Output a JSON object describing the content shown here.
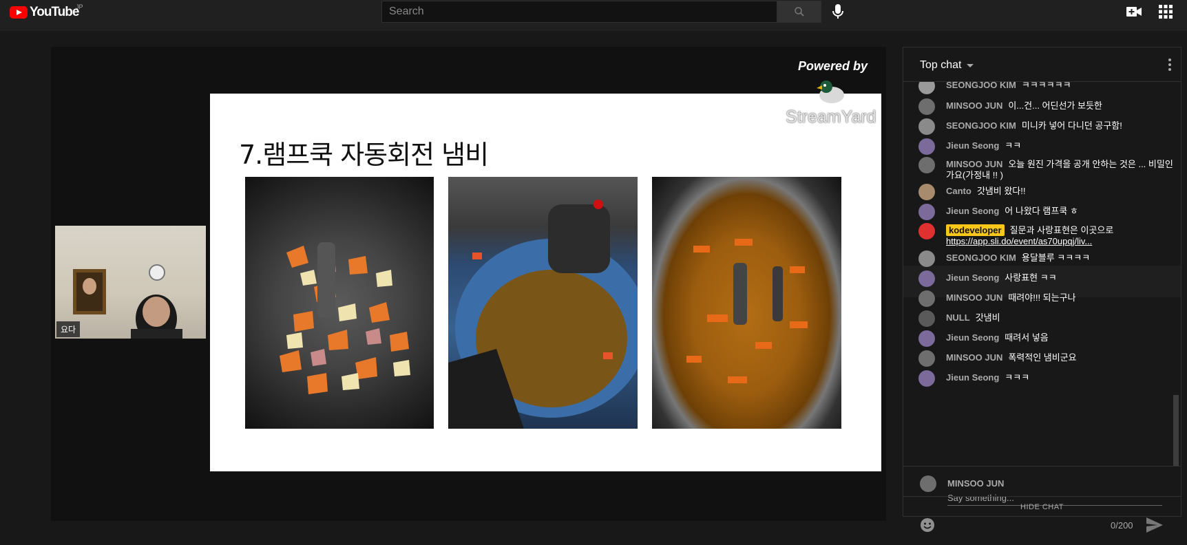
{
  "header": {
    "logo_text": "YouTube",
    "logo_region": "JP",
    "search_placeholder": "Search",
    "icons": [
      "youtube-logo",
      "search-icon",
      "mic-icon",
      "create-video-icon",
      "apps-icon"
    ]
  },
  "video": {
    "slide_title": "7.램프쿡 자동회전 냄비",
    "powered_by": "Powered by",
    "streamyard": "StreamYard",
    "presenter_name": "요다"
  },
  "chat": {
    "title": "Top chat",
    "messages": [
      {
        "author": "SEONGJOO KIM",
        "text": "ㅋㅋㅋㅋㅋㅋ",
        "avatar_color": "#9a9a9a"
      },
      {
        "author": "MINSOO JUN",
        "text": "이...건... 어딘선가 보듯한",
        "avatar_color": "#6e6e6e"
      },
      {
        "author": "SEONGJOO KIM",
        "text": "미니카 넣어 다니던 공구함!",
        "avatar_color": "#8a8a8a"
      },
      {
        "author": "Jieun Seong",
        "text": "ㅋㅋ",
        "avatar_color": "#7b6a9a"
      },
      {
        "author": "MINSOO JUN",
        "text": "오늘 원진 가격을 공개 안하는 것은 ... 비밀인가요(가정내 !! )",
        "avatar_color": "#6e6e6e"
      },
      {
        "author": "Canto",
        "text": "갓냄비 왔다!!",
        "avatar_color": "#a88b6c"
      },
      {
        "author": "Jieun Seong",
        "text": "어 나왔다 램프쿡 ㅎ",
        "avatar_color": "#7b6a9a"
      },
      {
        "author": "kodeveloper",
        "text": "질문과 사랑표현은 이곳으로",
        "link": "https://app.sli.do/event/as70upqj/liv...",
        "avatar_color": "#e03030",
        "moderator": true
      },
      {
        "author": "SEONGJOO KIM",
        "text": "용달블루 ㅋㅋㅋㅋ",
        "avatar_color": "#8a8a8a"
      },
      {
        "author": "Jieun Seong",
        "text": "사랑표현 ㅋㅋ",
        "avatar_color": "#7b6a9a"
      },
      {
        "author": "MINSOO JUN",
        "text": "때려야!!! 되는구나",
        "avatar_color": "#6e6e6e"
      },
      {
        "author": "NULL",
        "text": "갓냄비",
        "avatar_color": "#5a5a5a"
      },
      {
        "author": "Jieun Seong",
        "text": "때려서 넣음",
        "avatar_color": "#7b6a9a"
      },
      {
        "author": "MINSOO JUN",
        "text": "폭력적인 냄비군요",
        "avatar_color": "#6e6e6e"
      },
      {
        "author": "Jieun Seong",
        "text": "ㅋㅋㅋ",
        "avatar_color": "#7b6a9a"
      }
    ],
    "input": {
      "user": "MINSOO JUN",
      "placeholder": "Say something...",
      "counter": "0/200"
    },
    "hide_chat": "HIDE CHAT"
  }
}
